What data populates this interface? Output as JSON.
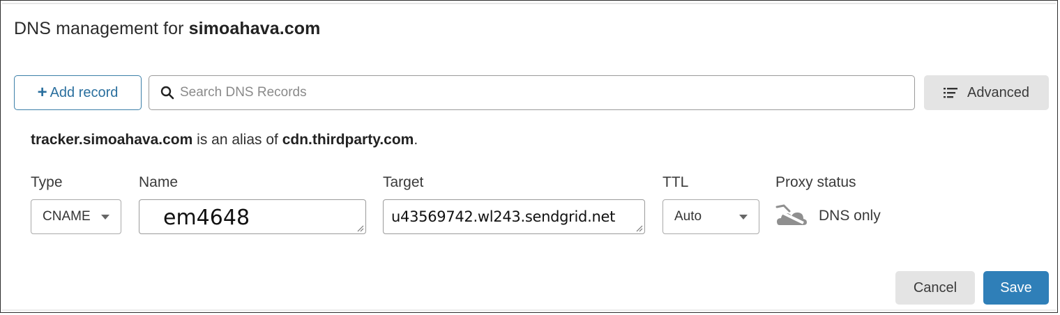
{
  "header": {
    "title_prefix": "DNS management for",
    "domain": "simoahava.com"
  },
  "toolbar": {
    "add_record_plus": "+",
    "add_record_label": "Add record",
    "search_placeholder": "Search DNS Records",
    "advanced_label": "Advanced"
  },
  "alias_message": {
    "host": "tracker.simoahava.com",
    "middle": " is an alias of ",
    "target": "cdn.thirdparty.com",
    "end": "."
  },
  "record_form": {
    "type": {
      "label": "Type",
      "value": "CNAME"
    },
    "name": {
      "label": "Name",
      "value": "em4648"
    },
    "target": {
      "label": "Target",
      "value": "u43569742.wl243.sendgrid.net"
    },
    "ttl": {
      "label": "TTL",
      "value": "Auto"
    },
    "proxy_status": {
      "label": "Proxy status",
      "value": "DNS only",
      "icon": "cloud-dns-only-icon"
    }
  },
  "actions": {
    "cancel_label": "Cancel",
    "save_label": "Save"
  },
  "colors": {
    "accent": "#2a6f9e",
    "save_button": "#2f7fb8",
    "secondary_button": "#e4e4e4",
    "input_border": "#9a9a9a"
  }
}
